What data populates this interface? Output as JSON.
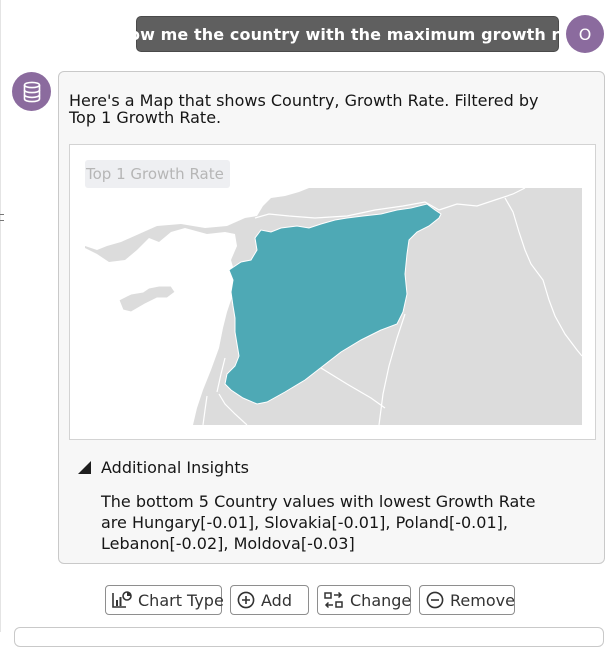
{
  "user_message": {
    "text": "Show me the country with the maximum growth rate",
    "avatar_initial": "O"
  },
  "bot": {
    "intro": "Here's a Map that shows Country, Growth Rate. Filtered by Top 1 Growth Rate.",
    "map": {
      "title": "Top 1 Growth Rate",
      "highlight_color": "#4ea9b5",
      "land_color": "#dcdcdc",
      "border_color": "#ffffff"
    },
    "insights": {
      "toggle_label": "Additional Insights",
      "text": "The bottom 5 Country values with lowest Growth Rate are Hungary[-0.01], Slovakia[-0.01], Poland[-0.01], Lebanon[-0.02], Moldova[-0.03]"
    }
  },
  "actions": [
    {
      "label": "Chart Type",
      "icon": "chart-type-icon"
    },
    {
      "label": "Add",
      "icon": "plus-circle-icon"
    },
    {
      "label": "Change",
      "icon": "swap-icon"
    },
    {
      "label": "Remove",
      "icon": "minus-circle-icon"
    }
  ],
  "colors": {
    "accent": "#8b6b9e",
    "user_bubble": "#5f5f5f"
  }
}
